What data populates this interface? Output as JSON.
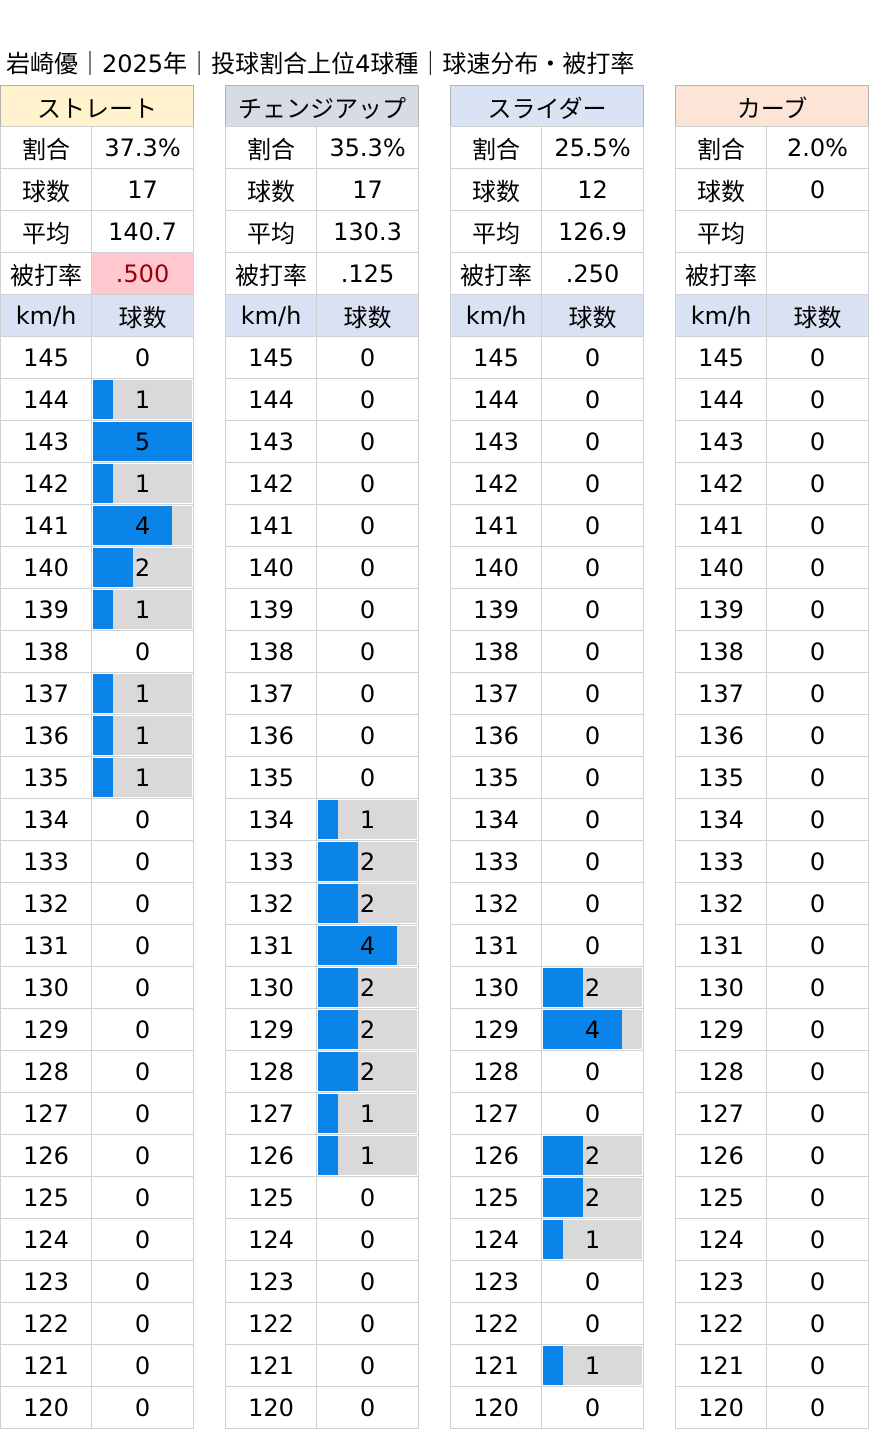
{
  "title": "岩崎優｜2025年｜投球割合上位4球種｜球速分布・被打率",
  "colors": {
    "header_fastball": "#fff2cc",
    "header_change": "#d6dce4",
    "header_slider": "#dae3f3",
    "header_curve": "#fce4d6",
    "axis_header": "#d9e1f2",
    "bar": "#0a84e8",
    "bar_track": "#d9d9d9",
    "highlight_bg": "#ffc7ce",
    "highlight_text": "#9c0006"
  },
  "labels": {
    "ratio": "割合",
    "count": "球数",
    "avg": "平均",
    "baa": "被打率",
    "speed_col": "km/h",
    "count_col": "球数"
  },
  "chart_data": {
    "type": "bar",
    "speeds": [
      145,
      144,
      143,
      142,
      141,
      140,
      139,
      138,
      137,
      136,
      135,
      134,
      133,
      132,
      131,
      130,
      129,
      128,
      127,
      126,
      125,
      124,
      123,
      122,
      121,
      120
    ],
    "max_value": 5,
    "series": [
      {
        "name": "ストレート",
        "ratio": "37.3%",
        "count": "17",
        "avg": "140.7",
        "baa": ".500",
        "baa_highlight": true,
        "header_color": "#fff2cc",
        "values": [
          0,
          1,
          5,
          1,
          4,
          2,
          1,
          0,
          1,
          1,
          1,
          0,
          0,
          0,
          0,
          0,
          0,
          0,
          0,
          0,
          0,
          0,
          0,
          0,
          0,
          0
        ]
      },
      {
        "name": "チェンジアップ",
        "ratio": "35.3%",
        "count": "17",
        "avg": "130.3",
        "baa": ".125",
        "baa_highlight": false,
        "header_color": "#d6dce4",
        "values": [
          0,
          0,
          0,
          0,
          0,
          0,
          0,
          0,
          0,
          0,
          0,
          1,
          2,
          2,
          4,
          2,
          2,
          2,
          1,
          1,
          0,
          0,
          0,
          0,
          0,
          0
        ]
      },
      {
        "name": "スライダー",
        "ratio": "25.5%",
        "count": "12",
        "avg": "126.9",
        "baa": ".250",
        "baa_highlight": false,
        "header_color": "#dae3f3",
        "values": [
          0,
          0,
          0,
          0,
          0,
          0,
          0,
          0,
          0,
          0,
          0,
          0,
          0,
          0,
          0,
          2,
          4,
          0,
          0,
          2,
          2,
          1,
          0,
          0,
          1,
          0
        ]
      },
      {
        "name": "カーブ",
        "ratio": "2.0%",
        "count": "0",
        "avg": "",
        "baa": "",
        "baa_highlight": false,
        "header_color": "#fce4d6",
        "values": [
          0,
          0,
          0,
          0,
          0,
          0,
          0,
          0,
          0,
          0,
          0,
          0,
          0,
          0,
          0,
          0,
          0,
          0,
          0,
          0,
          0,
          0,
          0,
          0,
          0,
          0
        ]
      }
    ]
  }
}
